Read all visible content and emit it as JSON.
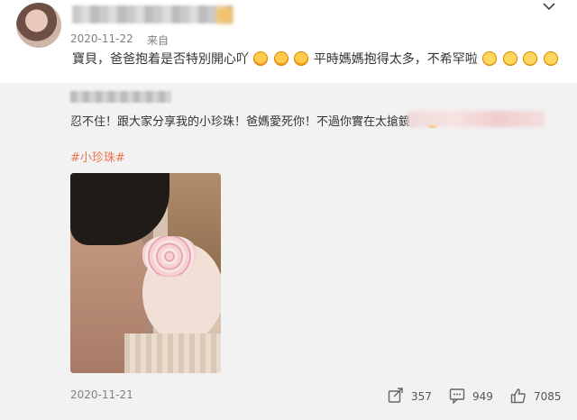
{
  "original_post": {
    "date": "2020-11-22",
    "via": "来自",
    "text_main": "寶貝，爸爸抱着是否特別開心吖",
    "text_mid": "平時媽媽抱得太多，不希罕啦"
  },
  "repost": {
    "text": "忍不住！跟大家分享我的小珍珠！爸媽愛死你！不過你實在太搶鏡！",
    "hashtag": "#小珍珠#",
    "date": "2020-11-21",
    "share_count": "357",
    "comment_count": "949",
    "like_count": "7085"
  },
  "colors": {
    "hashtag": "#eb7350",
    "repost_bg": "#f2f2f2",
    "meta_text": "#808080"
  },
  "icons": [
    "chevron-down-icon",
    "share-icon",
    "comment-icon",
    "like-icon"
  ]
}
